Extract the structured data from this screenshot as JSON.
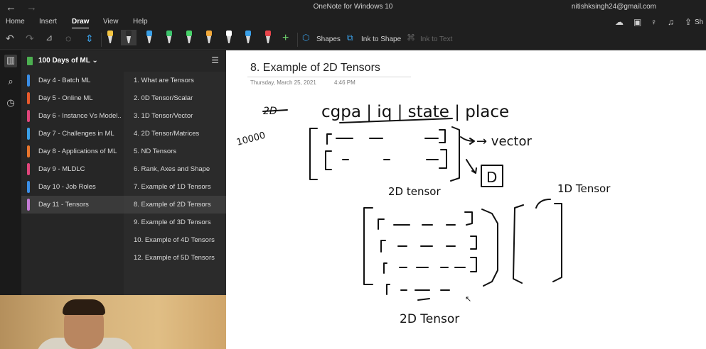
{
  "titlebar": {
    "back_glyph": "←",
    "forward_glyph": "→",
    "app_title": "OneNote for Windows 10",
    "account": "nitishksingh24@gmail.com"
  },
  "menu": {
    "items": [
      "Home",
      "Insert",
      "Draw",
      "View",
      "Help"
    ],
    "active": "Draw",
    "share_label": "Sh"
  },
  "toolbar": {
    "shapes_label": "Shapes",
    "ink_to_shape_label": "Ink to Shape",
    "ink_to_text_label": "Ink to Text",
    "pen_colors": [
      "#f4c542",
      "#2b2b2b",
      "#3aa0e8",
      "#3ec46d",
      "#49d26a",
      "#f2a93b",
      "#ffffff",
      "#3aa0e8",
      "#e8454b"
    ]
  },
  "notebook": {
    "name": "100 Days of ML",
    "color": "#4caf50"
  },
  "sections": [
    {
      "label": "Day 4 - Batch ML",
      "color": "#3a8ee6"
    },
    {
      "label": "Day 5 - Online ML",
      "color": "#e85a2c"
    },
    {
      "label": "Day 6 - Instance Vs Model...",
      "color": "#e0457b"
    },
    {
      "label": "Day 7 - Challenges in ML",
      "color": "#3aa0e8"
    },
    {
      "label": "Day 8 - Applications of ML",
      "color": "#e8752c"
    },
    {
      "label": "Day 9 - MLDLC",
      "color": "#e0457b"
    },
    {
      "label": "Day 10 - Job Roles",
      "color": "#3a8ee6"
    },
    {
      "label": "Day 11 - Tensors",
      "color": "#c57bd6"
    }
  ],
  "selected_section": 7,
  "pages": [
    "1. What are Tensors",
    "2. 0D Tensor/Scalar",
    "3. 1D Tensor/Vector",
    "4. 2D Tensor/Matrices",
    "5. ND Tensors",
    "6. Rank, Axes and Shape",
    "7. Example of 1D Tensors",
    "8. Example of 2D Tensors",
    "9. Example of 3D Tensors",
    "10. Example of 4D Tensors",
    "12. Example of 5D Tensors"
  ],
  "selected_page": 7,
  "page": {
    "title": "8. Example of 2D Tensors",
    "date": "Thursday, March 25, 2021",
    "time": "4:46 PM"
  },
  "ink_text": {
    "crossed": "2D",
    "header": "cgpa | iq | state | place",
    "rows": "10000",
    "vector": "→ vector",
    "d_box": "D",
    "tensor_2d_a": "2D tensor",
    "tensor_1d": "1D Tensor",
    "tensor_2d_b": "2D Tensor"
  }
}
